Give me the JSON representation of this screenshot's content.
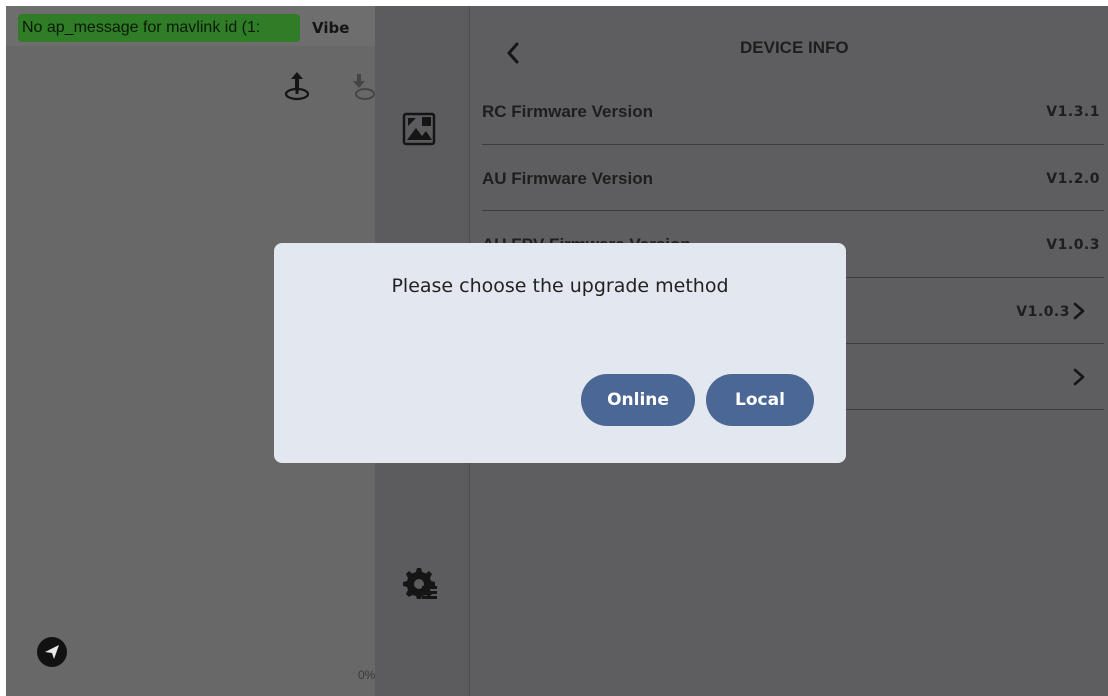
{
  "status": {
    "message": "No ap_message for mavlink id (1:",
    "vibe_label": "Vibe",
    "percent": "0%"
  },
  "device_info": {
    "title": "DEVICE INFO",
    "rows": [
      {
        "label": "RC Firmware Version",
        "value": "V1.3.1"
      },
      {
        "label": "AU Firmware Version",
        "value": "V1.2.0"
      },
      {
        "label": "AU FPV Firmware Version",
        "value": "V1.0.3"
      },
      {
        "label": "",
        "value": "V1.0.3"
      },
      {
        "label": "",
        "value": ""
      }
    ]
  },
  "dialog": {
    "title": "Please choose the upgrade method",
    "online_label": "Online",
    "local_label": "Local"
  },
  "icons": {
    "upload": "upload-icon",
    "download": "download-icon",
    "send": "send-icon",
    "firmware": "firmware-icon",
    "settings": "settings-gear-icon",
    "back": "back-chevron-icon",
    "row_chevron": "chevron-right-icon"
  },
  "colors": {
    "badge_bg": "#2f7d26",
    "dialog_bg": "#e3e7ef",
    "button_bg": "#4a6796"
  }
}
